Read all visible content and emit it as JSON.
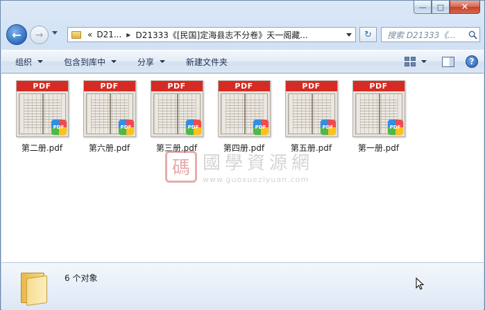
{
  "window": {
    "caption_buttons": {
      "minimize": "—",
      "maximize": "□",
      "close": "✕"
    }
  },
  "nav": {
    "back_glyph": "←",
    "forward_glyph": "→",
    "breadcrumb_prefix": "«",
    "crumbs": [
      "D21...",
      "D21333《[民国]定海县志不分卷》天一阁藏..."
    ],
    "refresh_glyph": "↻",
    "search_placeholder": "搜索 D21333《..."
  },
  "toolbar": {
    "organize": "组织",
    "include_library": "包含到库中",
    "share": "分享",
    "new_folder": "新建文件夹"
  },
  "files": [
    {
      "name": "第二册.pdf",
      "band": "PDF",
      "badge": "PDF"
    },
    {
      "name": "第六册.pdf",
      "band": "PDF",
      "badge": "PDF"
    },
    {
      "name": "第三册.pdf",
      "band": "PDF",
      "badge": "PDF"
    },
    {
      "name": "第四册.pdf",
      "band": "PDF",
      "badge": "PDF"
    },
    {
      "name": "第五册.pdf",
      "band": "PDF",
      "badge": "PDF"
    },
    {
      "name": "第一册.pdf",
      "band": "PDF",
      "badge": "PDF"
    }
  ],
  "watermark": {
    "seal": "碼",
    "chinese": "國學資源網",
    "url": "www.guoxueziyuan.com"
  },
  "details": {
    "object_count": "6 个对象"
  },
  "icons": {
    "back": "back-arrow-icon",
    "forward": "forward-arrow-icon",
    "search": "magnifier-icon",
    "help": "help-icon"
  }
}
